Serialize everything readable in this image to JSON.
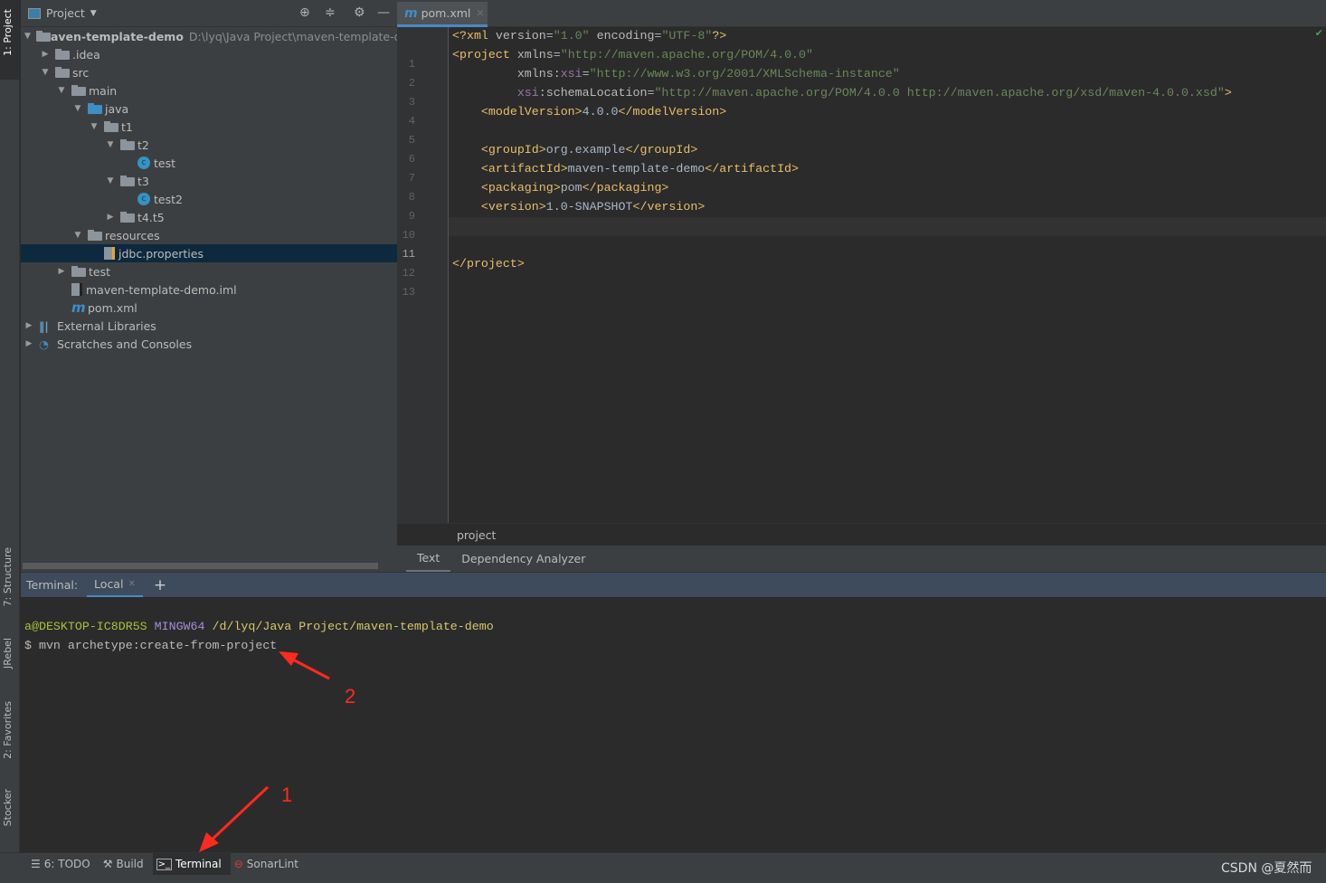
{
  "sidebar_left": {
    "project": "1: Project",
    "structure": "7: Structure",
    "jrebel": "JRebel",
    "favorites": "2: Favorites",
    "stocker": "Stocker"
  },
  "project_panel": {
    "title": "Project",
    "root_path": "D:\\lyq\\Java Project\\maven-template-demo",
    "tree": [
      {
        "label": "maven-template-demo",
        "level": 0,
        "arrow": "down",
        "icon": "module-folder",
        "bold": true
      },
      {
        "label": ".idea",
        "level": 1,
        "arrow": "right",
        "icon": "folder"
      },
      {
        "label": "src",
        "level": 1,
        "arrow": "down",
        "icon": "folder"
      },
      {
        "label": "main",
        "level": 2,
        "arrow": "down",
        "icon": "folder"
      },
      {
        "label": "java",
        "level": 3,
        "arrow": "down",
        "icon": "source-folder"
      },
      {
        "label": "t1",
        "level": 4,
        "arrow": "down",
        "icon": "package"
      },
      {
        "label": "t2",
        "level": 5,
        "arrow": "down",
        "icon": "package"
      },
      {
        "label": "test",
        "level": 6,
        "arrow": "",
        "icon": "class"
      },
      {
        "label": "t3",
        "level": 5,
        "arrow": "down",
        "icon": "package"
      },
      {
        "label": "test2",
        "level": 6,
        "arrow": "",
        "icon": "class"
      },
      {
        "label": "t4.t5",
        "level": 5,
        "arrow": "right",
        "icon": "package"
      },
      {
        "label": "resources",
        "level": 3,
        "arrow": "down",
        "icon": "resources-folder"
      },
      {
        "label": "jdbc.properties",
        "level": 4,
        "arrow": "",
        "icon": "properties-file",
        "selected": true
      },
      {
        "label": "test",
        "level": 2,
        "arrow": "right",
        "icon": "folder"
      },
      {
        "label": "maven-template-demo.iml",
        "level": 2,
        "arrow": "",
        "icon": "iml-file"
      },
      {
        "label": "pom.xml",
        "level": 2,
        "arrow": "",
        "icon": "maven-file"
      },
      {
        "label": "External Libraries",
        "level": 0,
        "arrow": "right",
        "icon": "libraries"
      },
      {
        "label": "Scratches and Consoles",
        "level": 0,
        "arrow": "right",
        "icon": "scratches"
      }
    ]
  },
  "editor": {
    "tab": "pom.xml",
    "breadcrumb": "project",
    "bottom_tabs": [
      "Text",
      "Dependency Analyzer"
    ],
    "current_line": 11,
    "lines": [
      [
        [
          "b",
          "<?xml "
        ],
        [
          "a",
          "version"
        ],
        [
          "x",
          "="
        ],
        [
          "v",
          "\"1.0\""
        ],
        [
          "a",
          " encoding"
        ],
        [
          "x",
          "="
        ],
        [
          "v",
          "\"UTF-8\""
        ],
        [
          "b",
          "?>"
        ]
      ],
      [
        [
          "b",
          "<project "
        ],
        [
          "a",
          "xmlns"
        ],
        [
          "x",
          "="
        ],
        [
          "v",
          "\"http://maven.apache.org/POM/4.0.0\""
        ]
      ],
      [
        [
          "a",
          "         xmlns:"
        ],
        [
          "n",
          "xsi"
        ],
        [
          "x",
          "="
        ],
        [
          "v",
          "\"http://www.w3.org/2001/XMLSchema-instance\""
        ]
      ],
      [
        [
          "n",
          "         xsi"
        ],
        [
          "a",
          ":schemaLocation"
        ],
        [
          "x",
          "="
        ],
        [
          "v",
          "\"http://maven.apache.org/POM/4.0.0 http://maven.apache.org/xsd/maven-4.0.0.xsd\""
        ],
        [
          "b",
          ">"
        ]
      ],
      [
        [
          "b",
          "    <modelVersion>"
        ],
        [
          "x",
          "4.0.0"
        ],
        [
          "b",
          "</modelVersion>"
        ]
      ],
      [],
      [
        [
          "b",
          "    <groupId>"
        ],
        [
          "x",
          "org.example"
        ],
        [
          "b",
          "</groupId>"
        ]
      ],
      [
        [
          "b",
          "    <artifactId>"
        ],
        [
          "x",
          "maven-template-demo"
        ],
        [
          "b",
          "</artifactId>"
        ]
      ],
      [
        [
          "b",
          "    <packaging>"
        ],
        [
          "x",
          "pom"
        ],
        [
          "b",
          "</packaging>"
        ]
      ],
      [
        [
          "b",
          "    <version>"
        ],
        [
          "x",
          "1.0-SNAPSHOT"
        ],
        [
          "b",
          "</version>"
        ]
      ],
      [],
      [],
      [
        [
          "b",
          "</project>"
        ]
      ]
    ]
  },
  "terminal": {
    "label": "Terminal:",
    "tab": "Local",
    "add": "+",
    "prompt_user": "a@DESKTOP-IC8DR5S",
    "prompt_sys": "MINGW64",
    "prompt_path": "/d/lyq/Java Project/maven-template-demo",
    "command": "$ mvn archetype:create-from-project"
  },
  "bottom_bar": {
    "todo": "6: TODO",
    "build": "Build",
    "terminal": "Terminal",
    "sonarlint": "SonarLint"
  },
  "annotations": {
    "one": "1",
    "two": "2",
    "color": "#ff2a1f"
  },
  "watermark": "CSDN @夏然而",
  "colors": {
    "accent": "#4a88c7",
    "selection": "#0d293e",
    "tag": "#e8bf6a",
    "value": "#6a8759",
    "namespace": "#9876aa"
  }
}
